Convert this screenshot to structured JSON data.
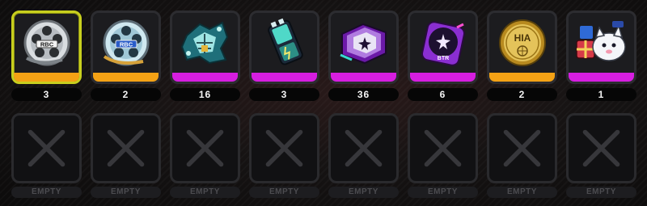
{
  "items": [
    {
      "name": "film-reel-silver-icon",
      "quantity": "3",
      "rarity_color": "#f4a215",
      "selected": true,
      "logo": "RBC"
    },
    {
      "name": "film-reel-blue-icon",
      "quantity": "2",
      "rarity_color": "#f4a215",
      "selected": false,
      "logo": "RBC"
    },
    {
      "name": "circuit-chip-icon",
      "quantity": "16",
      "rarity_color": "#d61ee0",
      "selected": false
    },
    {
      "name": "battery-cell-icon",
      "quantity": "3",
      "rarity_color": "#d61ee0",
      "selected": false
    },
    {
      "name": "purple-star-cube-icon",
      "quantity": "36",
      "rarity_color": "#d61ee0",
      "selected": false
    },
    {
      "name": "purple-disc-badge-icon",
      "quantity": "6",
      "rarity_color": "#d61ee0",
      "selected": false,
      "logo": "BTR"
    },
    {
      "name": "gold-hia-coin-icon",
      "quantity": "2",
      "rarity_color": "#f4a215",
      "selected": false,
      "logo": "HIA"
    },
    {
      "name": "cat-mascot-gifts-icon",
      "quantity": "1",
      "rarity_color": "#d61ee0",
      "selected": false
    }
  ],
  "empty_slots": [
    "EMPTY",
    "EMPTY",
    "EMPTY",
    "EMPTY",
    "EMPTY",
    "EMPTY",
    "EMPTY",
    "EMPTY"
  ]
}
